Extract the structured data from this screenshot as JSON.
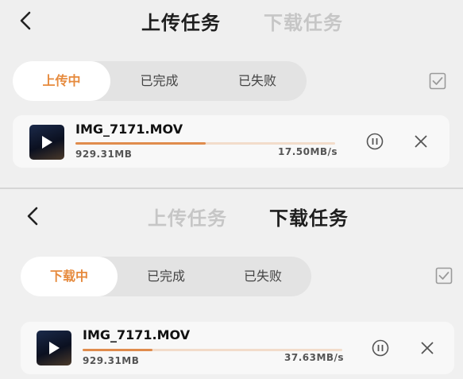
{
  "upload_screen": {
    "titles": {
      "upload": "上传任务",
      "download": "下载任务"
    },
    "active_title": "upload",
    "tabs": [
      "上传中",
      "已完成",
      "已失败"
    ],
    "active_tab": 0,
    "item": {
      "name": "IMG_7171.MOV",
      "size": "929.31MB",
      "speed": "17.50MB/s",
      "progress": 0.5
    }
  },
  "download_screen": {
    "titles": {
      "upload": "上传任务",
      "download": "下载任务"
    },
    "active_title": "download",
    "tabs": [
      "下载中",
      "已完成",
      "已失败"
    ],
    "active_tab": 0,
    "item": {
      "name": "IMG_7171.MOV",
      "size": "929.31MB",
      "speed": "37.63MB/s",
      "progress": 0.27
    }
  },
  "colors": {
    "accent": "#e68a3d",
    "progress_fill": "#e08c4d",
    "progress_track": "#f2dccb"
  },
  "icons": {
    "back": "chevron-left-icon",
    "select": "checkbox-icon",
    "pause": "pause-icon",
    "cancel": "close-icon",
    "thumbnail": "video-thumbnail"
  }
}
